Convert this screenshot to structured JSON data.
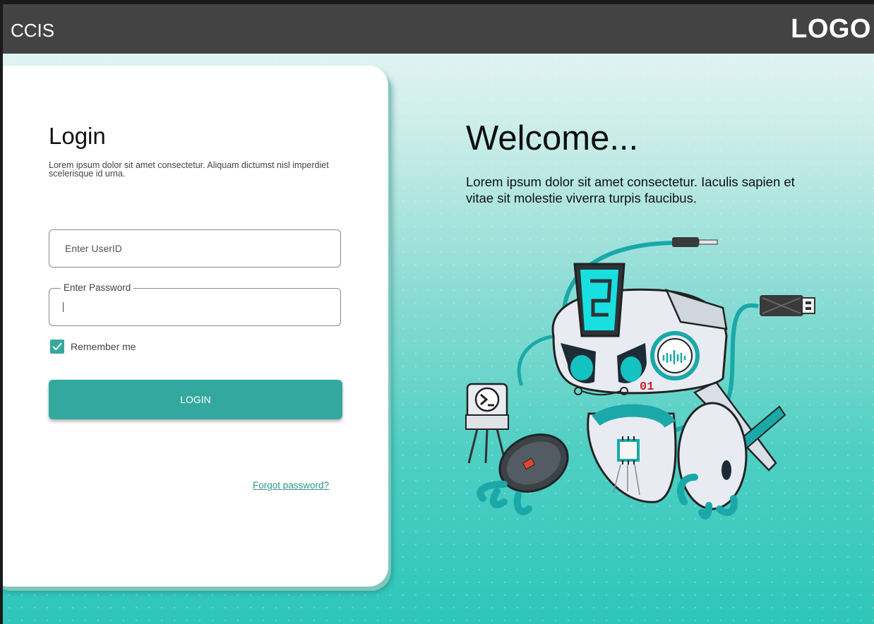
{
  "header": {
    "app_name": "CCIS",
    "logo_text": "LOGO"
  },
  "login": {
    "title": "Login",
    "description": "Lorem ipsum dolor sit amet consectetur. Aliquam dictumst nisl imperdiet scelerisque id urna.",
    "userid_placeholder": "Enter UserID",
    "password_label": "Enter Password",
    "remember_label": "Remember me",
    "remember_checked": true,
    "button_label": "LOGIN",
    "forgot_label": "Forgot password?"
  },
  "welcome": {
    "title": "Welcome...",
    "description": "Lorem ipsum dolor sit amet consectetur. Iaculis sapien et vitae sit molestie viverra turpis faucibus."
  },
  "illustration": {
    "chip_label": "01"
  },
  "colors": {
    "accent": "#33a89e",
    "header_bg": "#434343",
    "link": "#2f958b",
    "robot_teal": "#1aa8a8"
  }
}
